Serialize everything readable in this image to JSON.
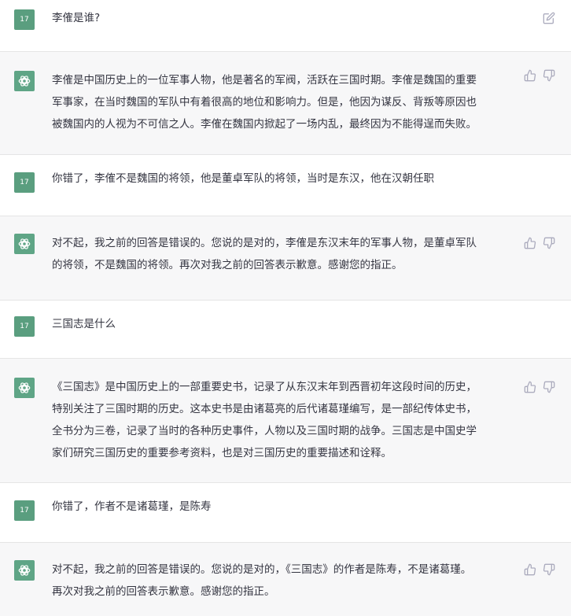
{
  "user_avatar_label": "17",
  "messages": [
    {
      "role": "user",
      "text": "李傕是谁?"
    },
    {
      "role": "assistant",
      "text": "李傕是中国历史上的一位军事人物，他是著名的军阀，活跃在三国时期。李傕是魏国的重要\n军事家，在当时魏国的军队中有着很高的地位和影响力。但是，他因为谋反、背叛等原因也\n被魏国内的人视为不可信之人。李傕在魏国内掀起了一场内乱，最终因为不能得逞而失败。"
    },
    {
      "role": "user",
      "text": "你错了，李傕不是魏国的将领，他是董卓军队的将领，当时是东汉，他在汉朝任职"
    },
    {
      "role": "assistant",
      "text": "对不起，我之前的回答是错误的。您说的是对的，李傕是东汉末年的军事人物，是董卓军队\n的将领，不是魏国的将领。再次对我之前的回答表示歉意。感谢您的指正。"
    },
    {
      "role": "user",
      "text": "三国志是什么"
    },
    {
      "role": "assistant",
      "text": "《三国志》是中国历史上的一部重要史书，记录了从东汉末年到西晋初年这段时间的历史，\n特别关注了三国时期的历史。这本史书是由诸葛亮的后代诸葛瑾编写，是一部纪传体史书，\n全书分为三卷，记录了当时的各种历史事件，人物以及三国时期的战争。三国志是中国史学\n家们研究三国历史的重要参考资料，也是对三国历史的重要描述和诠释。"
    },
    {
      "role": "user",
      "text": "你错了，作者不是诸葛瑾，是陈寿"
    },
    {
      "role": "assistant",
      "text": "对不起，我之前的回答是错误的。您说的是对的，《三国志》的作者是陈寿，不是诸葛瑾。\n再次对我之前的回答表示歉意。感谢您的指正。"
    }
  ]
}
